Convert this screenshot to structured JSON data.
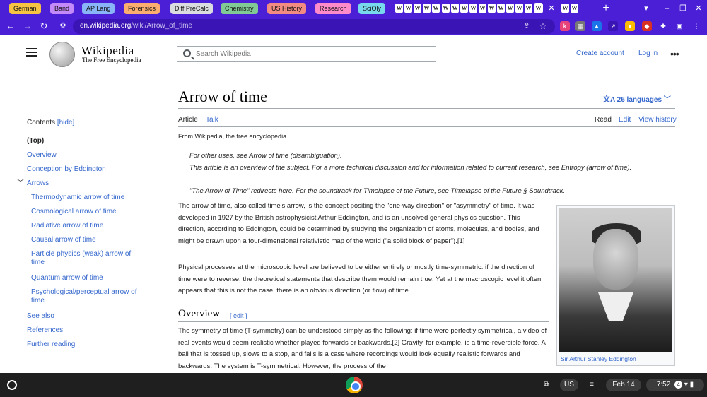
{
  "browser": {
    "tab_groups": [
      {
        "label": "German",
        "color": "#f6c343"
      },
      {
        "label": "Band",
        "color": "#c58af9"
      },
      {
        "label": "AP Lang",
        "color": "#8ab4f8"
      },
      {
        "label": "Forensics",
        "color": "#fcad70"
      },
      {
        "label": "Diff PreCalc",
        "color": "#dadce0"
      },
      {
        "label": "Chemistry",
        "color": "#81c995"
      },
      {
        "label": "US History",
        "color": "#f28b82"
      },
      {
        "label": "Research",
        "color": "#ff8bcb"
      },
      {
        "label": "SciOly",
        "color": "#78d9ec"
      }
    ],
    "pinned_tab_glyph": "W",
    "url": {
      "domain": "en.wikipedia.org",
      "path": "/wiki/Arrow_of_time"
    },
    "new_tab": "+",
    "close": "✕"
  },
  "wiki": {
    "wordmark": "Wikipedia",
    "tagline": "The Free Encyclopedia",
    "search_placeholder": "Search Wikipedia",
    "create_account": "Create account",
    "log_in": "Log in",
    "more": "•••",
    "title": "Arrow of time",
    "languages": "26 languages",
    "tabs_left": [
      "Article",
      "Talk"
    ],
    "tabs_right": [
      "Read",
      "Edit",
      "View history"
    ],
    "from": "From Wikipedia, the free encyclopedia",
    "hatnotes": [
      "For other uses, see Arrow of time (disambiguation).",
      "This article is an overview of the subject. For a more technical discussion and for information related to current research, see Entropy (arrow of time).",
      "\"The Arrow of Time\" redirects here. For the soundtrack for Timelapse of the Future, see Timelapse of the Future § Soundtrack."
    ],
    "paragraphs": [
      "The arrow of time, also called time's arrow, is the concept positing the \"one-way direction\" or \"asymmetry\" of time. It was developed in 1927 by the British astrophysicist Arthur Eddington, and is an unsolved general physics question. This direction, according to Eddington, could be determined by studying the organization of atoms, molecules, and bodies, and might be drawn upon a four-dimensional relativistic map of the world (\"a solid block of paper\").[1]",
      "Physical processes at the microscopic level are believed to be either entirely or mostly time-symmetric: if the direction of time were to reverse, the theoretical statements that describe them would remain true. Yet at the macroscopic level it often appears that this is not the case: there is an obvious direction (or flow) of time."
    ],
    "section_heading": "Overview",
    "section_edit": "[ edit ]",
    "section_paragraph": "The symmetry of time (T-symmetry) can be understood simply as the following: if time were perfectly symmetrical, a video of real events would seem realistic whether played forwards or backwards.[2] Gravity, for example, is a time-reversible force. A ball that is tossed up, slows to a stop, and falls is a case where recordings would look equally realistic forwards and backwards. The system is T-symmetrical. However, the process of the",
    "infobox_caption": "Sir Arthur Stanley Eddington",
    "toc": {
      "heading": "Contents",
      "hide": "[hide]",
      "items": [
        {
          "label": "(Top)",
          "bold": true
        },
        {
          "label": "Overview"
        },
        {
          "label": "Conception by Eddington"
        },
        {
          "label": "Arrows",
          "toggle": "﹀"
        },
        {
          "label": "Thermodynamic arrow of time",
          "indent": true
        },
        {
          "label": "Cosmological arrow of time",
          "indent": true
        },
        {
          "label": "Radiative arrow of time",
          "indent": true
        },
        {
          "label": "Causal arrow of time",
          "indent": true
        },
        {
          "label": "Particle physics (weak) arrow of time",
          "indent": true
        },
        {
          "label": "Quantum arrow of time",
          "indent": true
        },
        {
          "label": "Psychological/perceptual arrow of time",
          "indent": true
        },
        {
          "label": "See also"
        },
        {
          "label": "References"
        },
        {
          "label": "Further reading"
        }
      ]
    }
  },
  "shelf": {
    "ime": "US",
    "date": "Feb 14",
    "time": "7:52",
    "notification_count": "4"
  }
}
